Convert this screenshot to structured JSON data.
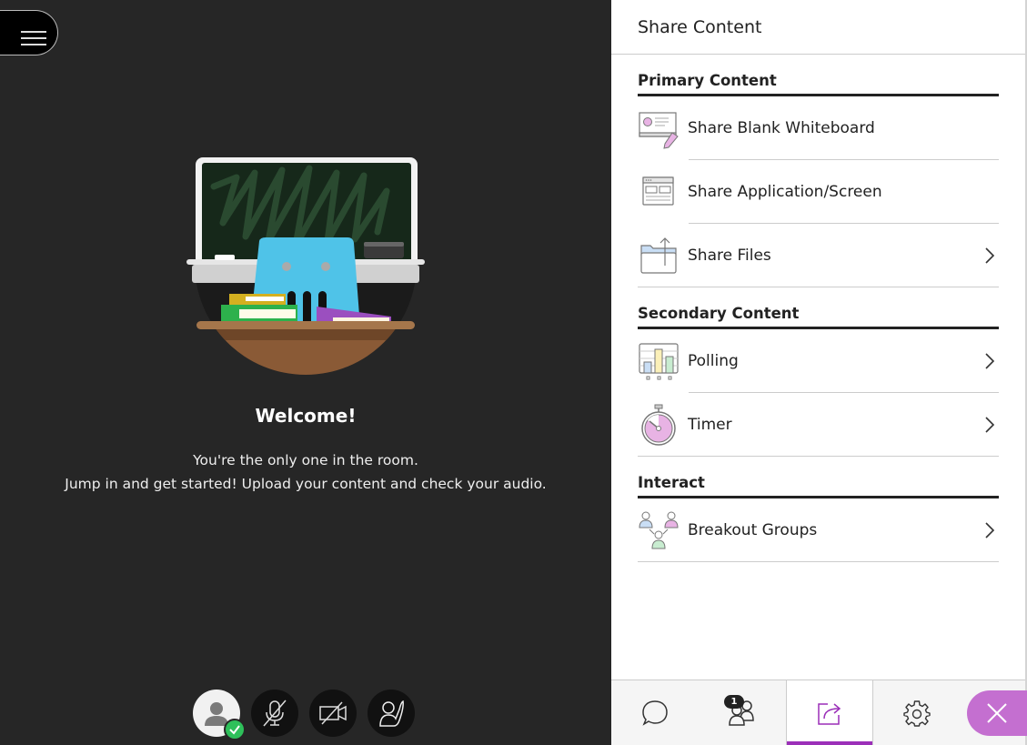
{
  "stage": {
    "menu_label": "Open session menu",
    "welcome_title": "Welcome!",
    "welcome_line1": "You're the only one in the room.",
    "welcome_line2": "Jump in and get started! Upload your content and check your audio.",
    "controls": [
      {
        "name": "my-status",
        "icon": "avatar-icon",
        "state": "present"
      },
      {
        "name": "microphone",
        "icon": "microphone-off-icon"
      },
      {
        "name": "camera",
        "icon": "camera-off-icon"
      },
      {
        "name": "raise-hand",
        "icon": "raise-hand-icon"
      }
    ]
  },
  "panel": {
    "title": "Share Content",
    "sections": [
      {
        "title": "Primary Content",
        "items": [
          {
            "label": "Share Blank Whiteboard",
            "icon": "whiteboard-icon",
            "has_chevron": false
          },
          {
            "label": "Share Application/Screen",
            "icon": "application-screen-icon",
            "has_chevron": false
          },
          {
            "label": "Share Files",
            "icon": "folder-upload-icon",
            "has_chevron": true
          }
        ]
      },
      {
        "title": "Secondary Content",
        "items": [
          {
            "label": "Polling",
            "icon": "poll-chart-icon",
            "has_chevron": true
          },
          {
            "label": "Timer",
            "icon": "stopwatch-icon",
            "has_chevron": true
          }
        ]
      },
      {
        "title": "Interact",
        "items": [
          {
            "label": "Breakout Groups",
            "icon": "breakout-groups-icon",
            "has_chevron": true
          }
        ]
      }
    ]
  },
  "tabbar": {
    "tabs": [
      {
        "name": "chat",
        "icon": "chat-bubble-icon",
        "active": false
      },
      {
        "name": "attendees",
        "icon": "attendees-icon",
        "active": false,
        "badge": "1"
      },
      {
        "name": "share-content",
        "icon": "share-icon",
        "active": true
      },
      {
        "name": "settings",
        "icon": "gear-icon",
        "active": false
      }
    ],
    "close_icon": "close-icon"
  },
  "colors": {
    "accent": "#9b2fb8",
    "close_button": "#c46fd0",
    "stage_bg": "#262626",
    "status_green": "#2ec05a"
  }
}
